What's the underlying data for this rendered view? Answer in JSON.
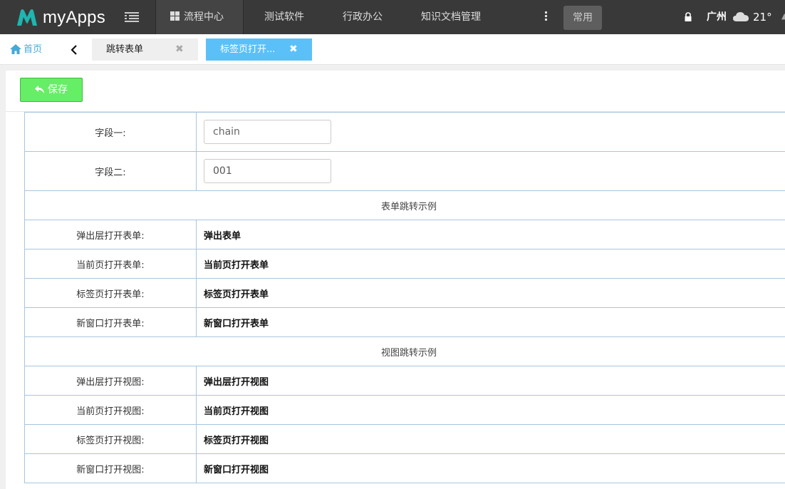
{
  "app": {
    "name": "myApps",
    "brand_color": "#1fb5b0"
  },
  "topnav": {
    "items": [
      "流程中心",
      "测试软件",
      "行政办公",
      "知识文档管理"
    ],
    "common_label": "常用"
  },
  "weather": {
    "city": "广州",
    "temperature": "21°",
    "icon": "cloud-icon"
  },
  "tabs": {
    "home_label": "首页",
    "items": [
      {
        "label": "跳转表单",
        "active": false
      },
      {
        "label": "标签页打开...",
        "active": true
      }
    ],
    "active_color": "#5bc0f8"
  },
  "toolbar": {
    "save_label": "保存",
    "save_color": "#66ee66"
  },
  "form": {
    "fields": [
      {
        "label": "字段一:",
        "value": "chain"
      },
      {
        "label": "字段二:",
        "value": "001"
      }
    ],
    "sections": [
      {
        "title": "表单跳转示例",
        "rows": [
          {
            "label": "弹出层打开表单:",
            "link": "弹出表单"
          },
          {
            "label": "当前页打开表单:",
            "link": "当前页打开表单"
          },
          {
            "label": "标签页打开表单:",
            "link": "标签页打开表单"
          },
          {
            "label": "新窗口打开表单:",
            "link": "新窗口打开表单"
          }
        ]
      },
      {
        "title": "视图跳转示例",
        "rows": [
          {
            "label": "弹出层打开视图:",
            "link": "弹出层打开视图"
          },
          {
            "label": "当前页打开视图:",
            "link": "当前页打开视图"
          },
          {
            "label": "标签页打开视图:",
            "link": "标签页打开视图"
          },
          {
            "label": "新窗口打开视图:",
            "link": "新窗口打开视图"
          }
        ]
      }
    ]
  }
}
